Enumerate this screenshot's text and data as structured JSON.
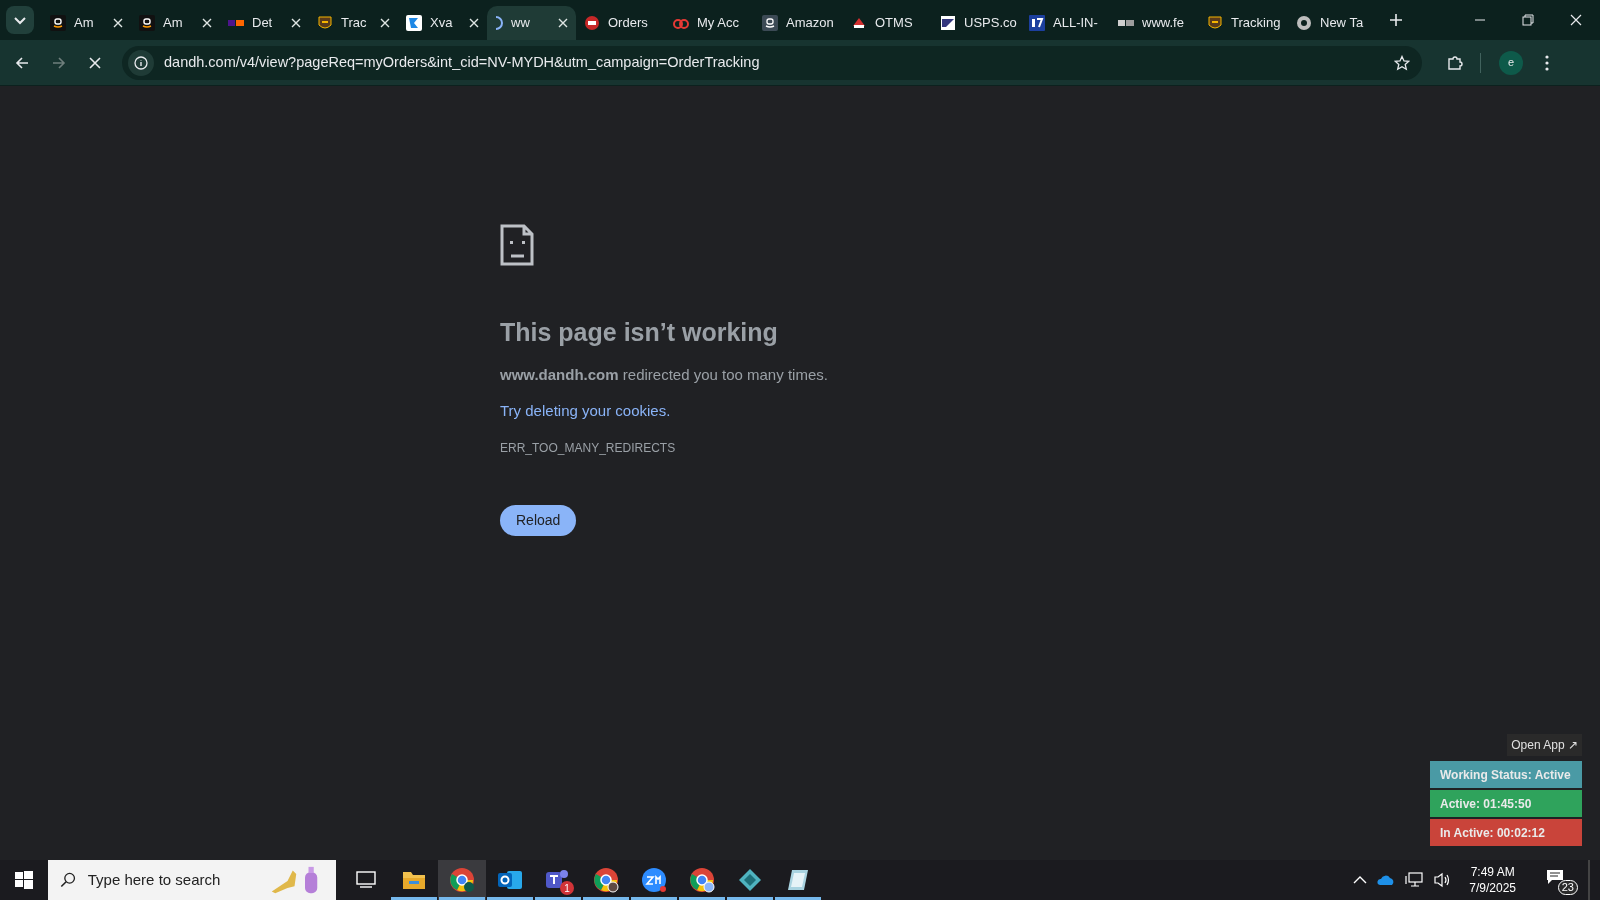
{
  "tabs": [
    {
      "title": "Am",
      "selected": false,
      "loading": false
    },
    {
      "title": "Am",
      "selected": false,
      "loading": false
    },
    {
      "title": "Det",
      "selected": false,
      "loading": false
    },
    {
      "title": "Trac",
      "selected": false,
      "loading": false
    },
    {
      "title": "Xva",
      "selected": false,
      "loading": false
    },
    {
      "title": "ww",
      "selected": true,
      "loading": true
    },
    {
      "title": "Orders",
      "selected": false,
      "loading": false
    },
    {
      "title": "My Acc",
      "selected": false,
      "loading": false
    },
    {
      "title": "Amazon",
      "selected": false,
      "loading": false
    },
    {
      "title": "OTMS",
      "selected": false,
      "loading": false
    },
    {
      "title": "USPS.co",
      "selected": false,
      "loading": false
    },
    {
      "title": "ALL-IN-",
      "selected": false,
      "loading": false
    },
    {
      "title": "www.fe",
      "selected": false,
      "loading": false
    },
    {
      "title": "Tracking",
      "selected": false,
      "loading": false
    },
    {
      "title": "New Ta",
      "selected": false,
      "loading": false
    }
  ],
  "toolbar": {
    "url": "dandh.com/v4/view?pageReq=myOrders&int_cid=NV-MYDH&utm_campaign=OrderTracking",
    "loading": true,
    "profile_initial": "e"
  },
  "error_page": {
    "heading": "This page isn’t working",
    "message": "**www.dandh.com** redirected you too many times.",
    "link": "Try deleting your cookies.",
    "code": "ERR_TOO_MANY_REDIRECTS",
    "button": "Reload"
  },
  "status_widget": {
    "open_app": "Open App ↗",
    "rows": [
      {
        "text": "Working Status: Active",
        "color": "#4a9aa5"
      },
      {
        "text": "Active: 01:45:50",
        "color": "#2fa35c"
      },
      {
        "text": "In Active: 00:02:12",
        "color": "#c9443a"
      }
    ]
  },
  "taskbar": {
    "search_placeholder": "Type here to search",
    "apps": [
      {
        "selected": false,
        "running": false
      },
      {
        "selected": false,
        "running": true
      },
      {
        "selected": true,
        "running": true
      },
      {
        "selected": false,
        "running": true
      },
      {
        "selected": false,
        "running": true,
        "badge": "1"
      },
      {
        "selected": false,
        "running": true
      },
      {
        "selected": false,
        "running": true
      },
      {
        "selected": false,
        "running": true
      },
      {
        "selected": false,
        "running": true
      },
      {
        "selected": false,
        "running": true
      }
    ],
    "time": "7:49 AM",
    "date": "7/9/2025",
    "notifications": "23"
  }
}
